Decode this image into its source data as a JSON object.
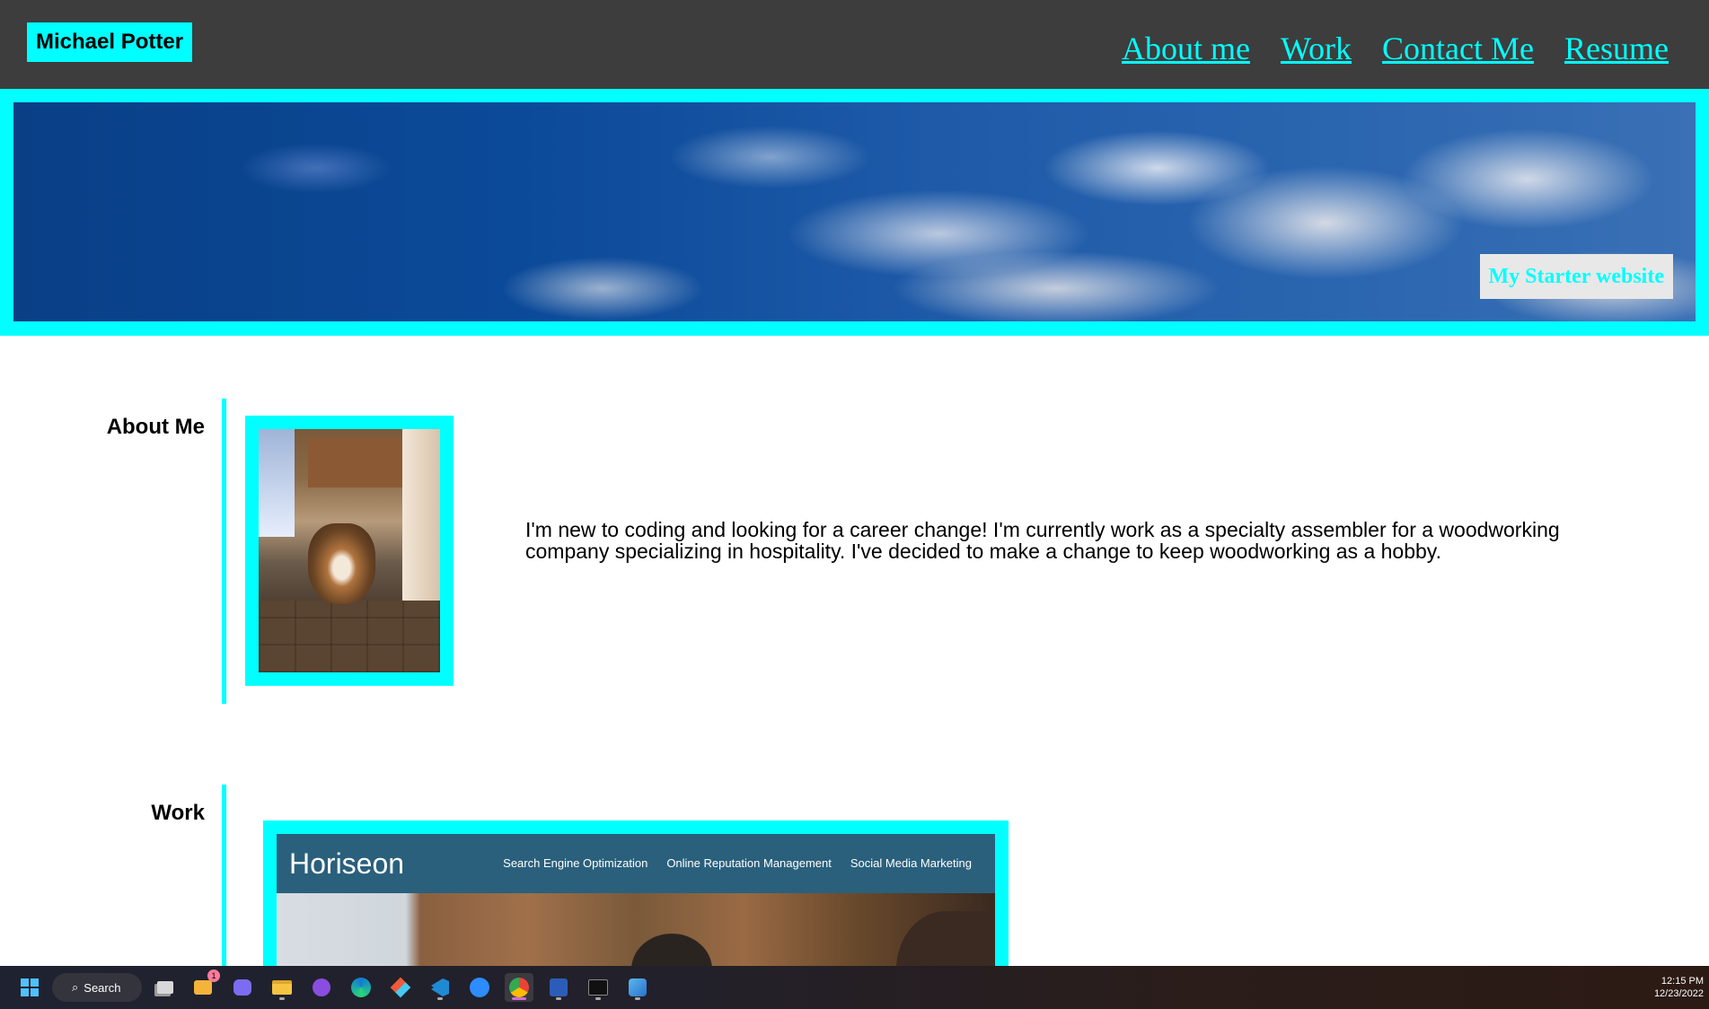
{
  "header": {
    "brand": "Michael Potter",
    "nav": [
      "About me",
      "Work",
      "Contact Me",
      "Resume"
    ]
  },
  "hero": {
    "tagline": "My Starter website"
  },
  "about": {
    "heading": "About Me",
    "text": "I'm new to coding and looking for a career change! I'm currently work as a specialty assembler for a woodworking company specializing in hospitality. I've decided to make a change to keep woodworking as a hobby."
  },
  "work": {
    "heading": "Work",
    "preview": {
      "logo": "Horiseon",
      "nav": [
        "Search Engine Optimization",
        "Online Reputation Management",
        "Social Media Marketing"
      ]
    }
  },
  "taskbar": {
    "search_label": "Search",
    "time": "12:15 PM",
    "date": "12/23/2022",
    "notification_count": "1",
    "apps": [
      "file-explorer-icon",
      "widgets-icon",
      "chat-icon",
      "folder-icon",
      "github-desktop-icon",
      "edge-icon",
      "git-icon",
      "vscode-icon",
      "zoom-icon",
      "chrome-icon",
      "word-icon",
      "terminal-icon",
      "photos-icon"
    ]
  },
  "colors": {
    "accent": "#00ffff",
    "header_bg": "#3d3d3d",
    "horiseon_bar": "#2a607c"
  }
}
